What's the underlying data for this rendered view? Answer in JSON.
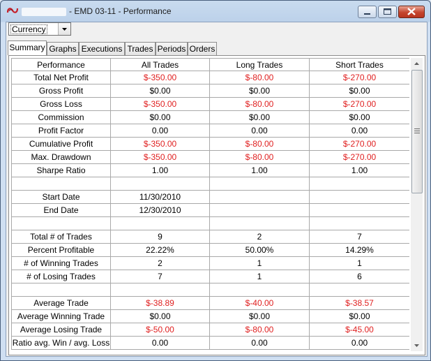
{
  "window": {
    "title": "- EMD 03-11 - Performance",
    "controls": {
      "minimize": "minimize",
      "maximize": "maximize",
      "close": "close"
    }
  },
  "toolbar": {
    "currency_select": "Currency"
  },
  "tabs": [
    {
      "label": "Summary",
      "active": true
    },
    {
      "label": "Graphs",
      "active": false
    },
    {
      "label": "Executions",
      "active": false
    },
    {
      "label": "Trades",
      "active": false
    },
    {
      "label": "Periods",
      "active": false
    },
    {
      "label": "Orders",
      "active": false
    }
  ],
  "colors": {
    "negative": "#e02020",
    "positive": "#000000"
  },
  "table": {
    "columns": [
      "Performance",
      "All Trades",
      "Long Trades",
      "Short Trades"
    ],
    "rows": [
      {
        "label": "Total Net Profit",
        "values": [
          "$-350.00",
          "$-80.00",
          "$-270.00"
        ],
        "negative": true
      },
      {
        "label": "Gross Profit",
        "values": [
          "$0.00",
          "$0.00",
          "$0.00"
        ],
        "negative": false
      },
      {
        "label": "Gross Loss",
        "values": [
          "$-350.00",
          "$-80.00",
          "$-270.00"
        ],
        "negative": true
      },
      {
        "label": "Commission",
        "values": [
          "$0.00",
          "$0.00",
          "$0.00"
        ],
        "negative": false
      },
      {
        "label": "Profit Factor",
        "values": [
          "0.00",
          "0.00",
          "0.00"
        ],
        "negative": false
      },
      {
        "label": "Cumulative Profit",
        "values": [
          "$-350.00",
          "$-80.00",
          "$-270.00"
        ],
        "negative": true
      },
      {
        "label": "Max. Drawdown",
        "values": [
          "$-350.00",
          "$-80.00",
          "$-270.00"
        ],
        "negative": true
      },
      {
        "label": "Sharpe Ratio",
        "values": [
          "1.00",
          "1.00",
          "1.00"
        ],
        "negative": false
      },
      {
        "label": "",
        "values": [
          "",
          "",
          ""
        ],
        "negative": false
      },
      {
        "label": "Start Date",
        "values": [
          "11/30/2010",
          "",
          ""
        ],
        "negative": false
      },
      {
        "label": "End Date",
        "values": [
          "12/30/2010",
          "",
          ""
        ],
        "negative": false
      },
      {
        "label": "",
        "values": [
          "",
          "",
          ""
        ],
        "negative": false
      },
      {
        "label": "Total # of Trades",
        "values": [
          "9",
          "2",
          "7"
        ],
        "negative": false
      },
      {
        "label": "Percent Profitable",
        "values": [
          "22.22%",
          "50.00%",
          "14.29%"
        ],
        "negative": false
      },
      {
        "label": "# of Winning Trades",
        "values": [
          "2",
          "1",
          "1"
        ],
        "negative": false
      },
      {
        "label": "# of Losing Trades",
        "values": [
          "7",
          "1",
          "6"
        ],
        "negative": false
      },
      {
        "label": "",
        "values": [
          "",
          "",
          ""
        ],
        "negative": false
      },
      {
        "label": "Average Trade",
        "values": [
          "$-38.89",
          "$-40.00",
          "$-38.57"
        ],
        "negative": true
      },
      {
        "label": "Average Winning Trade",
        "values": [
          "$0.00",
          "$0.00",
          "$0.00"
        ],
        "negative": false
      },
      {
        "label": "Average Losing Trade",
        "values": [
          "$-50.00",
          "$-80.00",
          "$-45.00"
        ],
        "negative": true
      },
      {
        "label": "Ratio avg. Win / avg. Loss",
        "values": [
          "0.00",
          "0.00",
          "0.00"
        ],
        "negative": false
      }
    ]
  }
}
